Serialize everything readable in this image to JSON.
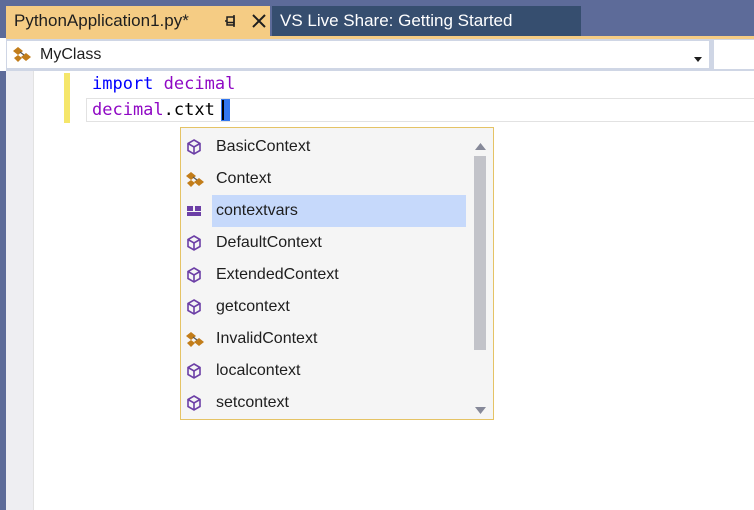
{
  "tabs": [
    {
      "label": "PythonApplication1.py*",
      "active": true
    },
    {
      "label": "VS Live Share: Getting Started",
      "active": false
    }
  ],
  "navigation": {
    "class_selector": "MyClass"
  },
  "code": {
    "line1": {
      "keyword": "import",
      "module": "decimal"
    },
    "line2": {
      "module": "decimal",
      "typed": ".ctxt"
    }
  },
  "completion": {
    "selected_index": 2,
    "items": [
      {
        "label": "BasicContext",
        "icon": "cube-icon"
      },
      {
        "label": "Context",
        "icon": "class-icon"
      },
      {
        "label": "contextvars",
        "icon": "module-icon"
      },
      {
        "label": "DefaultContext",
        "icon": "cube-icon"
      },
      {
        "label": "ExtendedContext",
        "icon": "cube-icon"
      },
      {
        "label": "getcontext",
        "icon": "cube-icon"
      },
      {
        "label": "InvalidContext",
        "icon": "class-icon"
      },
      {
        "label": "localcontext",
        "icon": "cube-icon"
      },
      {
        "label": "setcontext",
        "icon": "cube-icon"
      }
    ]
  },
  "colors": {
    "active_tab": "#f5cc84",
    "keyword": "#0000ff",
    "module": "#8f08c4",
    "selection": "#c6d9fb",
    "popup_border": "#e5c365"
  }
}
